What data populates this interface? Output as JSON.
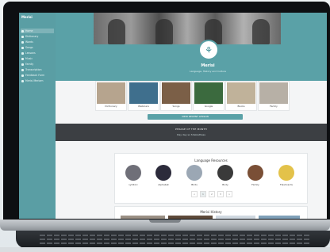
{
  "app": {
    "name": "Merisi",
    "tagline": "Language, History and Culture"
  },
  "sidebar": {
    "title": "Merisi",
    "items": [
      {
        "label": "Home",
        "active": true
      },
      {
        "label": "Dictionary"
      },
      {
        "label": "Words"
      },
      {
        "label": "Songs"
      },
      {
        "label": "Lessons"
      },
      {
        "label": "Music"
      },
      {
        "label": "Family"
      },
      {
        "label": "Transcription"
      },
      {
        "label": "Feedback Form"
      },
      {
        "label": "Merisi Meriam"
      }
    ]
  },
  "tiles": [
    {
      "label": "Dictionary",
      "color": "#b6a48e"
    },
    {
      "label": "Webinars",
      "color": "#3f6f8d"
    },
    {
      "label": "Songs",
      "color": "#7b5f47"
    },
    {
      "label": "Google",
      "color": "#3b6a3e"
    },
    {
      "label": "Books",
      "color": "#c0b29a"
    },
    {
      "label": "Family",
      "color": "#b7b0a6"
    }
  ],
  "cta_label": "VIEW RECENT LESSON",
  "band": {
    "line1": "PHRASE OF THE MONTH",
    "line2": "Day day so Shakiethass"
  },
  "resources": {
    "title": "Language Resources",
    "items": [
      {
        "label": "Lyhitori",
        "color": "#6f6f78"
      },
      {
        "label": "Alphabet",
        "color": "#2c2b3b"
      },
      {
        "label": "Birds",
        "color": "#9ba7b4"
      },
      {
        "label": "Body",
        "color": "#3a3a3a"
      },
      {
        "label": "Family",
        "color": "#7a4f36"
      },
      {
        "label": "Flashcards",
        "color": "#e3c24a"
      }
    ],
    "pager": [
      "<",
      "1",
      "2",
      "3",
      ">"
    ]
  },
  "history": {
    "title": "Merisi History"
  }
}
